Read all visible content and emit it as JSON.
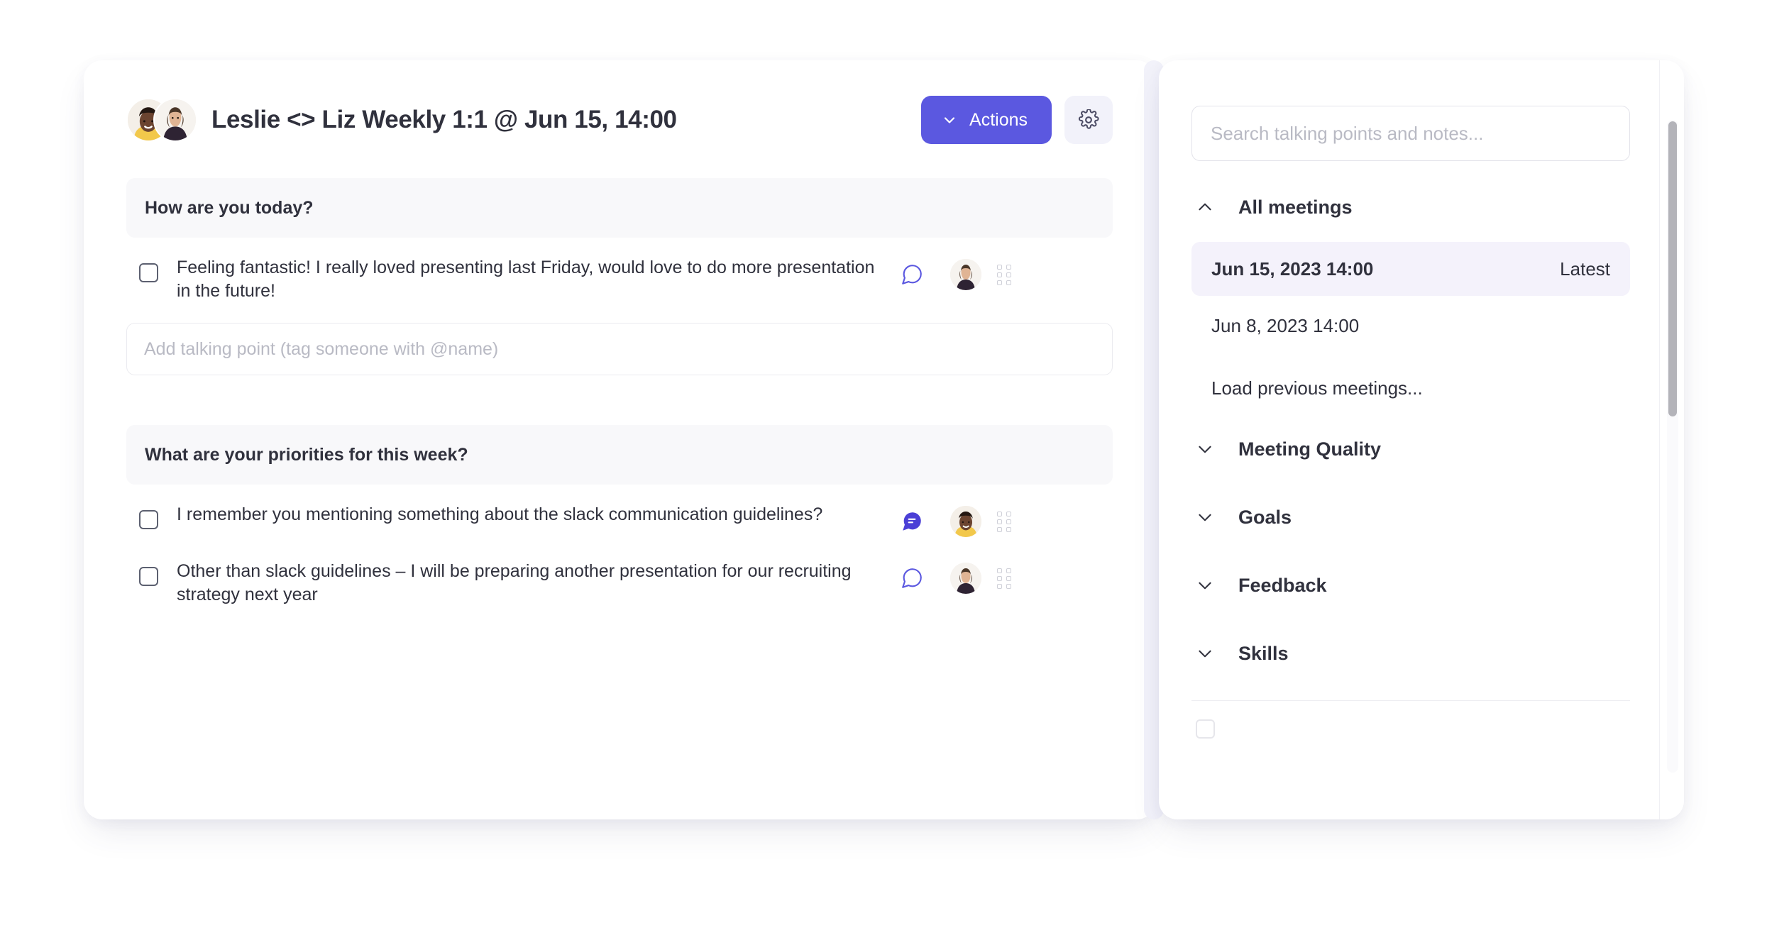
{
  "meeting": {
    "title": "Leslie <> Liz Weekly 1:1 @ Jun 15, 14:00",
    "actions_button": "Actions",
    "settings_icon": "gear-icon",
    "chevron_icon": "chevron-down-icon",
    "avatar_1": "leslie-avatar",
    "avatar_2": "liz-avatar"
  },
  "sections": [
    {
      "question": "How are you today?",
      "talking_points": [
        {
          "text": "Feeling fantastic! I really loved presenting last Friday, would love to do more presentation in the future!",
          "checked": false,
          "comment_state": "empty",
          "author_avatar": "liz-avatar"
        }
      ],
      "input_placeholder": "Add talking point (tag someone with @name)",
      "input_value": ""
    },
    {
      "question": "What are your priorities for this week?",
      "talking_points": [
        {
          "text": "I remember you mentioning something about the slack communication guidelines?",
          "checked": false,
          "comment_state": "filled",
          "author_avatar": "leslie-avatar"
        },
        {
          "text": "Other than slack guidelines – I will be preparing another presentation for our recruiting strategy next year",
          "checked": false,
          "comment_state": "empty",
          "author_avatar": "liz-avatar"
        }
      ]
    }
  ],
  "sidebar": {
    "search_placeholder": "Search talking points and notes...",
    "search_value": "",
    "all_meetings": {
      "label": "All meetings",
      "expanded": true,
      "chevron_icon": "chevron-up-icon"
    },
    "meetings": [
      {
        "date": "Jun 15, 2023 14:00",
        "tag": "Latest",
        "selected": true
      },
      {
        "date": "Jun 8, 2023 14:00",
        "tag": "",
        "selected": false
      }
    ],
    "load_more": "Load previous meetings...",
    "categories": [
      {
        "label": "Meeting Quality",
        "expanded": false,
        "chevron_icon": "chevron-down-icon"
      },
      {
        "label": "Goals",
        "expanded": false,
        "chevron_icon": "chevron-down-icon"
      },
      {
        "label": "Feedback",
        "expanded": false,
        "chevron_icon": "chevron-down-icon"
      },
      {
        "label": "Skills",
        "expanded": false,
        "chevron_icon": "chevron-down-icon"
      }
    ]
  },
  "colors": {
    "accent": "#5b58e0",
    "accent_soft": "#f2f2fa",
    "selected_row": "#f4f2fb",
    "section_bg": "#f8f8fa",
    "text": "#30313d",
    "muted": "#b9bac4"
  }
}
